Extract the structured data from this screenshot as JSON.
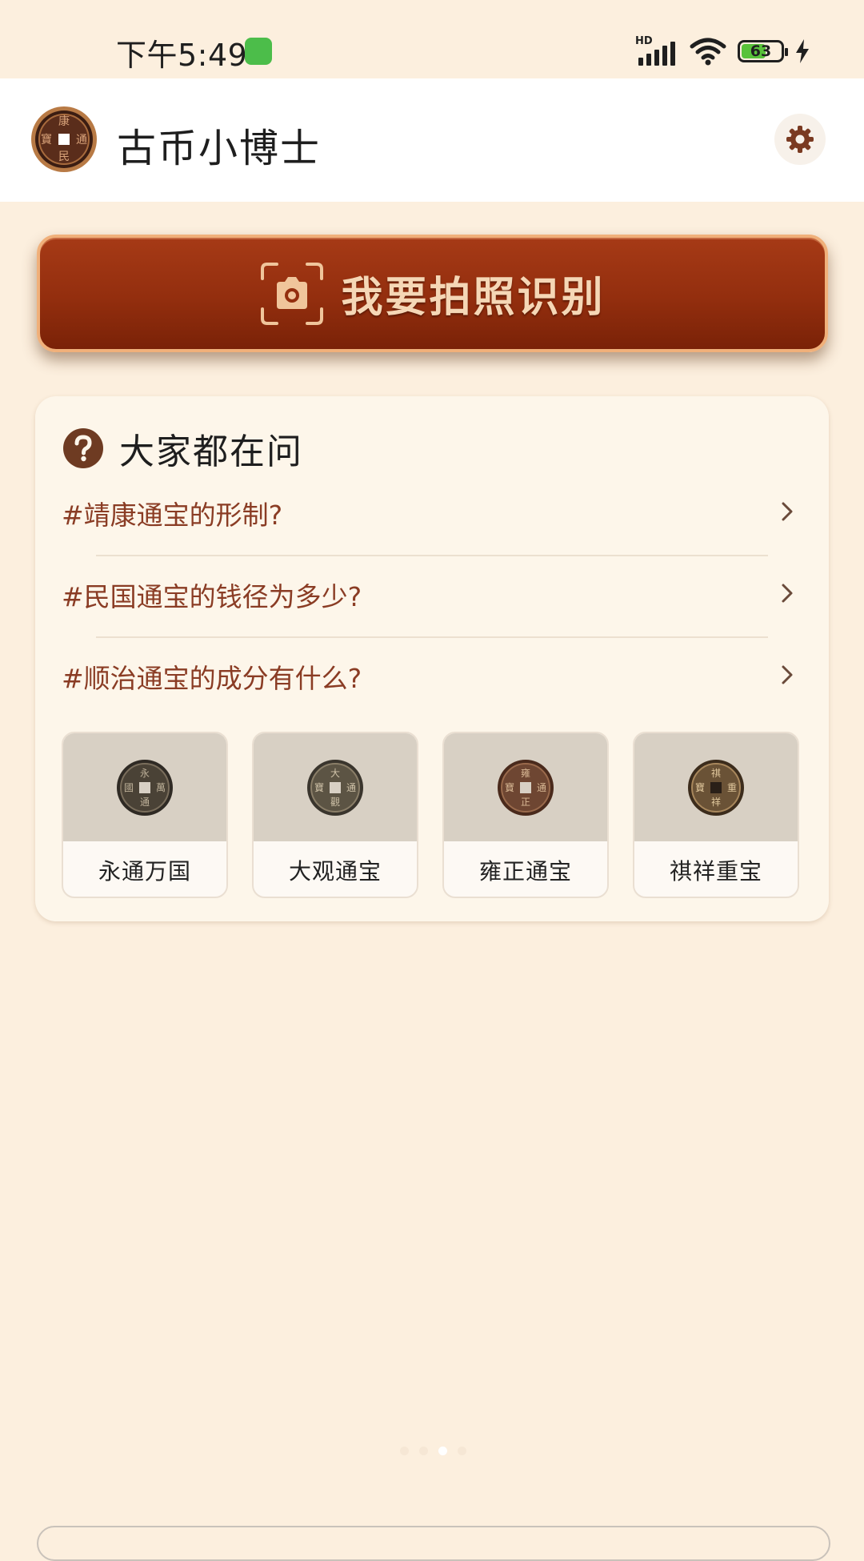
{
  "status_bar": {
    "time": "下午5:49",
    "network_label": "HD",
    "battery_level": "63",
    "battery_fraction": 0.63
  },
  "header": {
    "title": "古币小博士",
    "logo_icon": "ancient-coin-logo-icon",
    "settings_icon": "gear-icon"
  },
  "camera_button": {
    "label": "我要拍照识别",
    "icon": "camera-icon"
  },
  "faq": {
    "title": "大家都在问",
    "icon": "help-icon",
    "items": [
      {
        "text": "#靖康通宝的形制?"
      },
      {
        "text": "#民国通宝的钱径为多少?"
      },
      {
        "text": "#顺治通宝的成分有什么?"
      }
    ],
    "coins": [
      {
        "name": "永通万国"
      },
      {
        "name": "大观通宝"
      },
      {
        "name": "雍正通宝"
      },
      {
        "name": "祺祥重宝"
      }
    ]
  },
  "pager": {
    "page_count": 4,
    "active_page": 3
  },
  "colors": {
    "background": "#fcefde",
    "accent": "#8a3c24",
    "button": "#932e0e",
    "button_text": "#f5d7b6"
  }
}
